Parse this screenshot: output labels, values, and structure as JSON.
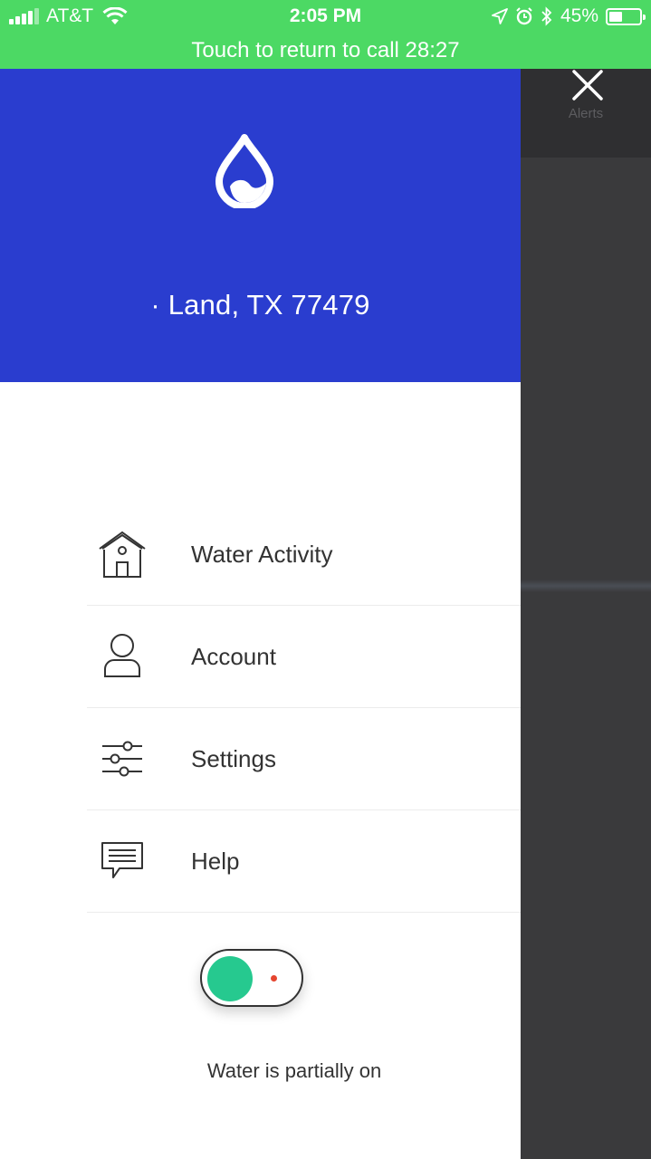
{
  "status_bar": {
    "carrier": "AT&T",
    "time": "2:05 PM",
    "battery": "45%",
    "battery_level": 0.45
  },
  "call_banner": "Touch to return to call 28:27",
  "overlay": {
    "alerts_label": "Alerts"
  },
  "drawer": {
    "address": "· Land, TX 77479",
    "menu": [
      {
        "label": "Water Activity",
        "icon": "house-icon"
      },
      {
        "label": "Account",
        "icon": "person-icon"
      },
      {
        "label": "Settings",
        "icon": "sliders-icon"
      },
      {
        "label": "Help",
        "icon": "chat-icon"
      }
    ],
    "water_status": "Water is partially on"
  },
  "colors": {
    "status_green": "#4cd964",
    "header_blue": "#2a3dcf",
    "toggle_green": "#26c98f",
    "indicator_red": "#e5452f"
  }
}
